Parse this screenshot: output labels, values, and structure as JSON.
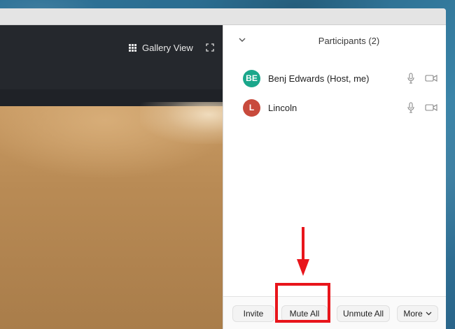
{
  "video": {
    "gallery_view_label": "Gallery View"
  },
  "panel": {
    "title": "Participants (2)",
    "participants": [
      {
        "initials": "BE",
        "name": "Benj Edwards (Host, me)",
        "color": "#1aa78b"
      },
      {
        "initials": "L",
        "name": "Lincoln",
        "color": "#c84a3c"
      }
    ],
    "footer": {
      "invite_label": "Invite",
      "mute_all_label": "Mute All",
      "unmute_all_label": "Unmute All",
      "more_label": "More"
    }
  },
  "annotations": {
    "highlight_color": "#e8151b"
  }
}
